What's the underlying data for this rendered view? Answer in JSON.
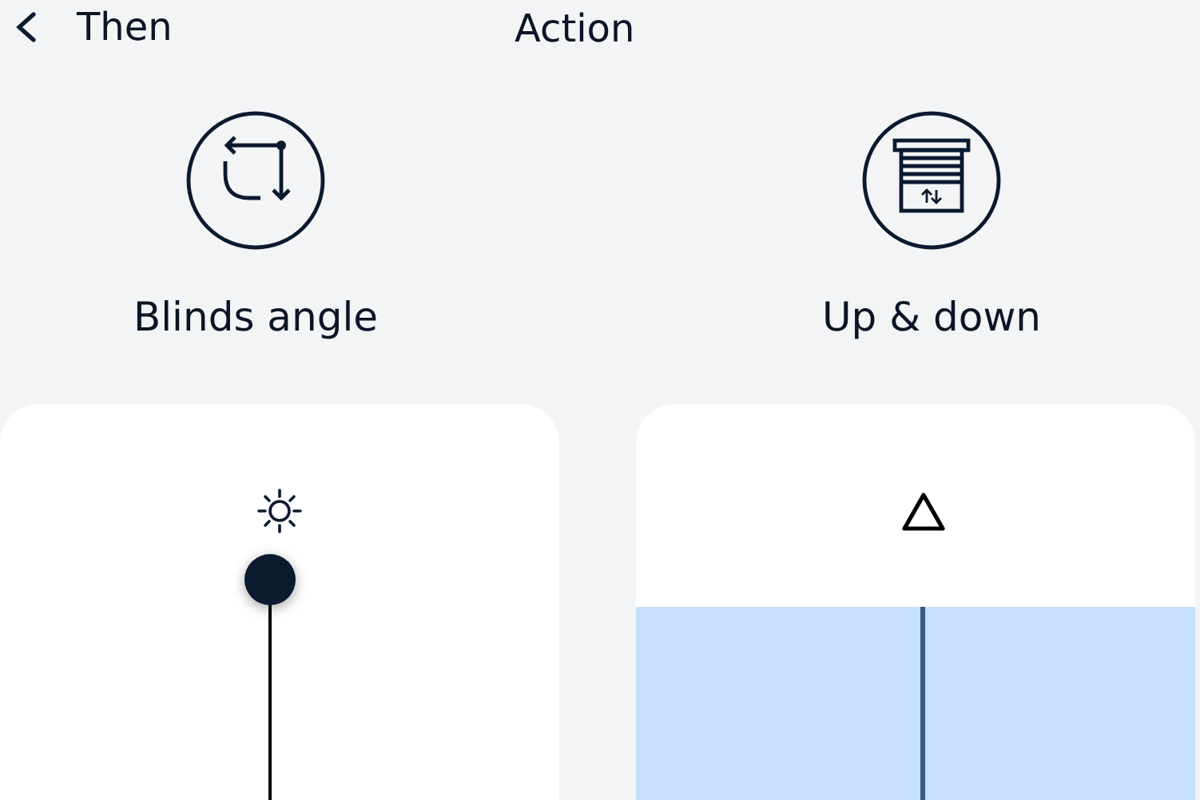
{
  "header": {
    "back_label": "Then",
    "title": "Action"
  },
  "options": [
    {
      "kind": "angle",
      "label": "Blinds angle"
    },
    {
      "kind": "updown",
      "label": "Up & down"
    }
  ],
  "controls": [
    {
      "kind": "angle-slider",
      "level": 1
    },
    {
      "kind": "position-panel"
    }
  ]
}
